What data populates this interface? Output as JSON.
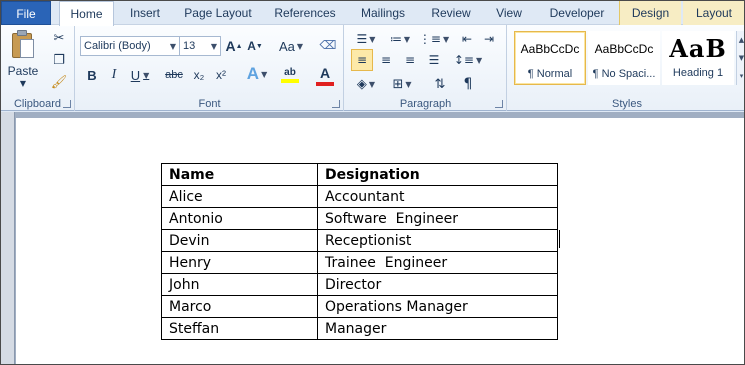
{
  "tabs": {
    "file": "File",
    "home": "Home",
    "insert": "Insert",
    "page_layout": "Page Layout",
    "references": "References",
    "mailings": "Mailings",
    "review": "Review",
    "view": "View",
    "developer": "Developer",
    "design": "Design",
    "layout": "Layout"
  },
  "ribbon": {
    "clipboard": {
      "label": "Clipboard",
      "paste": "Paste"
    },
    "font": {
      "label": "Font",
      "font_name": "Calibri (Body)",
      "font_size": "13",
      "change_case": "Aa",
      "bold": "B",
      "italic": "I",
      "underline": "U",
      "strike": "abc",
      "subscript": "x₂",
      "superscript": "x²",
      "text_effects": "A",
      "highlight_text": "ab",
      "font_color_letter": "A",
      "highlight_color": "#ffff00",
      "font_color": "#e02020"
    },
    "paragraph": {
      "label": "Paragraph"
    },
    "styles": {
      "label": "Styles",
      "items": [
        {
          "sample": "AaBbCcDc",
          "name": "¶ Normal"
        },
        {
          "sample": "AaBbCcDc",
          "name": "¶ No Spaci..."
        },
        {
          "sample": "AaB",
          "name": "Heading 1"
        }
      ]
    }
  },
  "table": {
    "headers": [
      "Name",
      "Designation"
    ],
    "rows": [
      [
        "Alice",
        "Accountant"
      ],
      [
        "Antonio",
        "Software  Engineer"
      ],
      [
        "Devin",
        "Receptionist"
      ],
      [
        "Henry",
        "Trainee  Engineer"
      ],
      [
        "John",
        "Director"
      ],
      [
        "Marco",
        "Operations Manager"
      ],
      [
        "Steffan",
        "Manager"
      ]
    ]
  }
}
